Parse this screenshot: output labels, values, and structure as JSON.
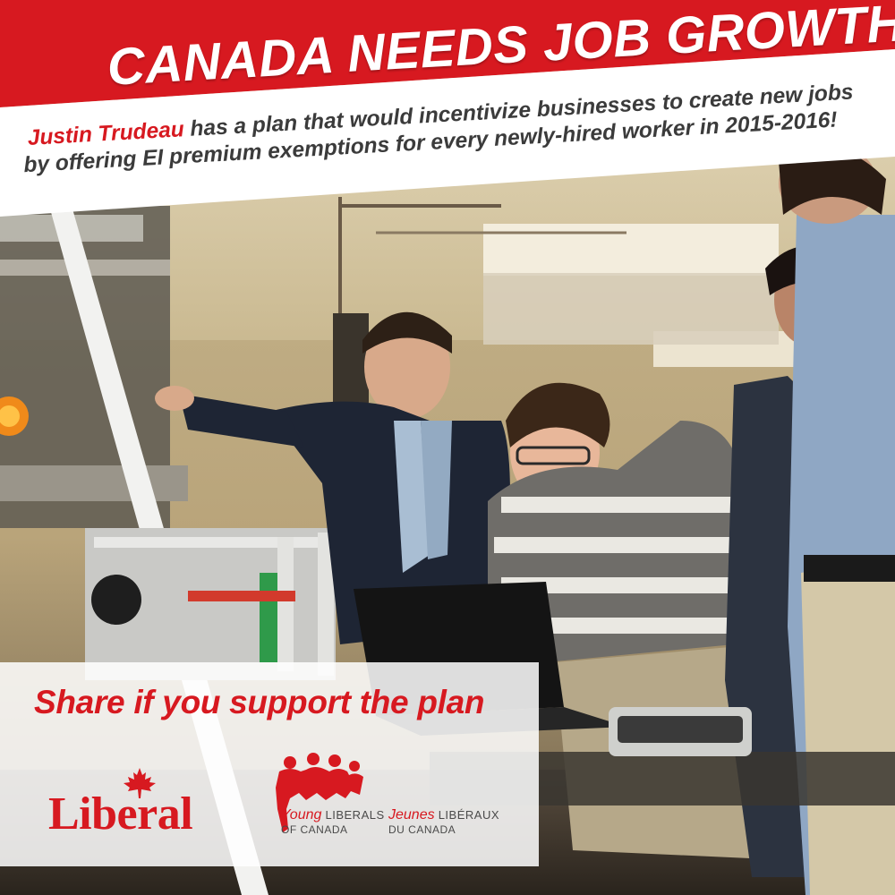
{
  "banner": {
    "headline": "CANADA NEEDS JOB GROWTH!",
    "subline_name": "Justin Trudeau",
    "subline_line1_rest": " has a plan that would incentivize businesses to create new jobs",
    "subline_line2": "by offering EI premium exemptions for every newly-hired worker in 2015-2016!"
  },
  "cta": {
    "text": "Share if you support the plan"
  },
  "logos": {
    "liberal_word": "Liberal",
    "ylc_en_lead": "Young",
    "ylc_en_rest": " LIBERALS",
    "ylc_en_sub": "OF CANADA",
    "ylc_fr_lead": "Jeunes",
    "ylc_fr_rest": " LIBÉRAUX",
    "ylc_fr_sub": "DU CANADA"
  },
  "colors": {
    "brand_red": "#d71920",
    "panel_white": "#ffffff"
  }
}
